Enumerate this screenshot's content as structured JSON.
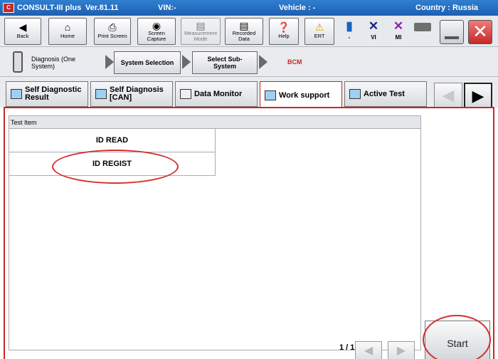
{
  "titlebar": {
    "logo": "C",
    "app": "CONSULT-III plus",
    "version": "Ver.81.11",
    "vin": "VIN:-",
    "vehicle": "Vehicle : -",
    "country": "Country : Russia"
  },
  "toolbar": {
    "back": "Back",
    "home": "Home",
    "print": "Print Screen",
    "capture_1": "Screen",
    "capture_2": "Capture",
    "measure_1": "Measurement",
    "measure_2": "Mode",
    "recorded_1": "Recorded",
    "recorded_2": "Data",
    "help": "Help",
    "ert": "ERT",
    "car_label": "-",
    "vi": "VI",
    "mi": "MI"
  },
  "breadcrumb": {
    "diag_1": "Diagnosis (One",
    "diag_2": "System)",
    "system_selection": "System Selection",
    "select_sub_1": "Select Sub-",
    "select_sub_2": "System",
    "current": "BCM"
  },
  "tabs": {
    "self_diag_result_1": "Self Diagnostic",
    "self_diag_result_2": "Result",
    "self_diag_can_1": "Self Diagnosis",
    "self_diag_can_2": "[CAN]",
    "data_monitor": "Data Monitor",
    "work_support": "Work support",
    "active_test": "Active Test"
  },
  "list": {
    "header": "Test Item",
    "items": [
      "ID READ",
      "ID REGIST"
    ]
  },
  "pager": {
    "text": "1 / 1"
  },
  "start_label": "Start",
  "colors": {
    "accent_red": "#c62828",
    "titlebar_blue": "#1e5fb0"
  }
}
